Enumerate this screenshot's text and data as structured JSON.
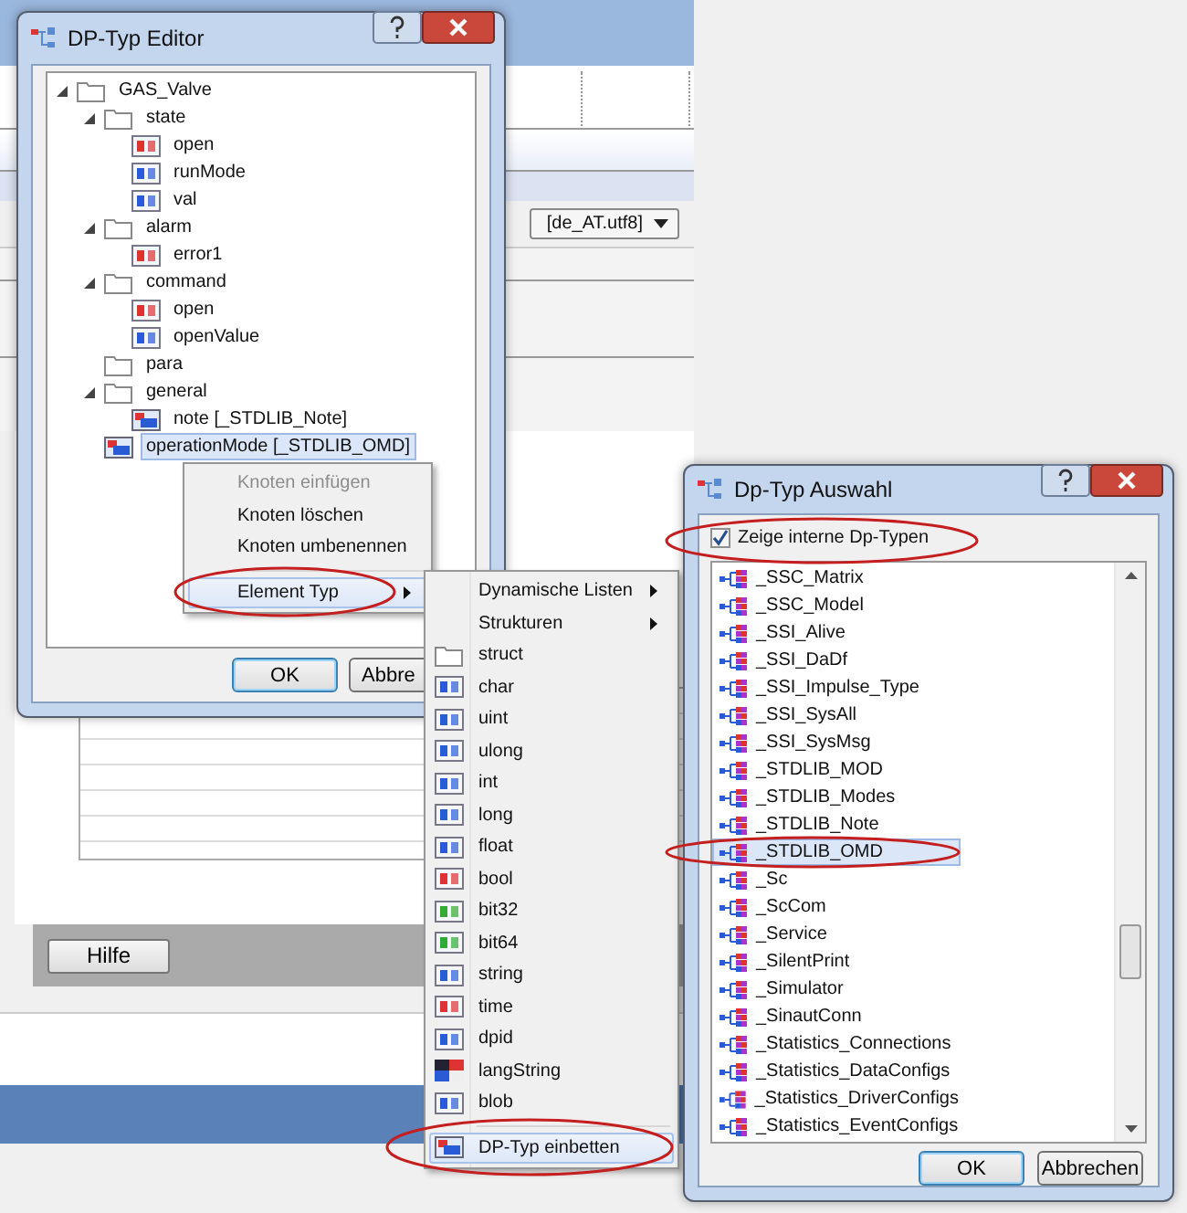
{
  "background_window": {
    "locale_dropdown": "[de_AT.utf8]",
    "help_button": "Hilfe"
  },
  "editor_dialog": {
    "title": "DP-Typ Editor",
    "tree": [
      {
        "label": "GAS_Valve",
        "kind": "folder",
        "expanded": true,
        "selected": false,
        "children": [
          {
            "label": "state",
            "kind": "folder",
            "expanded": true,
            "selected": false,
            "children": [
              {
                "label": "open",
                "kind": "bool",
                "selected": false
              },
              {
                "label": "runMode",
                "kind": "int",
                "selected": false
              },
              {
                "label": "val",
                "kind": "float",
                "selected": false
              }
            ]
          },
          {
            "label": "alarm",
            "kind": "folder",
            "expanded": true,
            "selected": false,
            "children": [
              {
                "label": "error1",
                "kind": "bool",
                "selected": false
              }
            ]
          },
          {
            "label": "command",
            "kind": "folder",
            "expanded": true,
            "selected": false,
            "children": [
              {
                "label": "open",
                "kind": "bool",
                "selected": false
              },
              {
                "label": "openValue",
                "kind": "float",
                "selected": false
              }
            ]
          },
          {
            "label": "para",
            "kind": "folder",
            "expanded": false,
            "selected": false
          },
          {
            "label": "general",
            "kind": "folder",
            "expanded": true,
            "selected": false,
            "children": [
              {
                "label": "note [_STDLIB_Note]",
                "kind": "embedded",
                "selected": false
              }
            ]
          },
          {
            "label": "operationMode [_STDLIB_OMD]",
            "kind": "embedded",
            "selected": true
          }
        ]
      }
    ],
    "buttons": [
      "OK",
      "Abbre"
    ]
  },
  "context_menu": {
    "items": [
      {
        "label": "Knoten einfügen",
        "disabled": true,
        "selected": false,
        "submenu": false
      },
      {
        "label": "Knoten löschen",
        "disabled": false,
        "selected": false,
        "submenu": false
      },
      {
        "label": "Knoten umbenennen",
        "disabled": false,
        "selected": false,
        "submenu": false
      },
      {
        "label": "Element Typ",
        "disabled": false,
        "selected": true,
        "submenu": true,
        "separator_before": true
      }
    ]
  },
  "element_type_menu": {
    "items": [
      {
        "label": "Dynamische Listen",
        "kind": "none",
        "submenu": true,
        "selected": false
      },
      {
        "label": "Strukturen",
        "kind": "none",
        "submenu": true,
        "selected": false
      },
      {
        "label": "struct",
        "kind": "folder",
        "submenu": false,
        "selected": false
      },
      {
        "label": "char",
        "kind": "char",
        "submenu": false,
        "selected": false
      },
      {
        "label": "uint",
        "kind": "uint",
        "submenu": false,
        "selected": false
      },
      {
        "label": "ulong",
        "kind": "ulong",
        "submenu": false,
        "selected": false
      },
      {
        "label": "int",
        "kind": "int",
        "submenu": false,
        "selected": false
      },
      {
        "label": "long",
        "kind": "long",
        "submenu": false,
        "selected": false
      },
      {
        "label": "float",
        "kind": "float",
        "submenu": false,
        "selected": false
      },
      {
        "label": "bool",
        "kind": "bool",
        "submenu": false,
        "selected": false
      },
      {
        "label": "bit32",
        "kind": "bit",
        "submenu": false,
        "selected": false
      },
      {
        "label": "bit64",
        "kind": "bit",
        "submenu": false,
        "selected": false
      },
      {
        "label": "string",
        "kind": "string",
        "submenu": false,
        "selected": false
      },
      {
        "label": "time",
        "kind": "time",
        "submenu": false,
        "selected": false
      },
      {
        "label": "dpid",
        "kind": "dpid",
        "submenu": false,
        "selected": false
      },
      {
        "label": "langString",
        "kind": "flag",
        "submenu": false,
        "selected": false
      },
      {
        "label": "blob",
        "kind": "blob",
        "submenu": false,
        "selected": false
      },
      {
        "label": "DP-Typ einbetten",
        "kind": "embedded",
        "submenu": false,
        "selected": true,
        "separator_before": true
      }
    ]
  },
  "type_dialog": {
    "title": "Dp-Typ Auswahl",
    "show_internal": {
      "label": "Zeige interne Dp-Typen",
      "checked": true
    },
    "list": [
      {
        "label": "_SSC_Matrix",
        "selected": false
      },
      {
        "label": "_SSC_Model",
        "selected": false
      },
      {
        "label": "_SSI_Alive",
        "selected": false
      },
      {
        "label": "_SSI_DaDf",
        "selected": false
      },
      {
        "label": "_SSI_Impulse_Type",
        "selected": false
      },
      {
        "label": "_SSI_SysAll",
        "selected": false
      },
      {
        "label": "_SSI_SysMsg",
        "selected": false
      },
      {
        "label": "_STDLIB_MOD",
        "selected": false
      },
      {
        "label": "_STDLIB_Modes",
        "selected": false
      },
      {
        "label": "_STDLIB_Note",
        "selected": false
      },
      {
        "label": "_STDLIB_OMD",
        "selected": true
      },
      {
        "label": "_Sc",
        "selected": false
      },
      {
        "label": "_ScCom",
        "selected": false
      },
      {
        "label": "_Service",
        "selected": false
      },
      {
        "label": "_SilentPrint",
        "selected": false
      },
      {
        "label": "_Simulator",
        "selected": false
      },
      {
        "label": "_SinautConn",
        "selected": false
      },
      {
        "label": "_Statistics_Connections",
        "selected": false
      },
      {
        "label": "_Statistics_DataConfigs",
        "selected": false
      },
      {
        "label": "_Statistics_DriverConfigs",
        "selected": false
      },
      {
        "label": "_Statistics_EventConfigs",
        "selected": false
      }
    ],
    "buttons": [
      "OK",
      "Abbrechen"
    ]
  }
}
